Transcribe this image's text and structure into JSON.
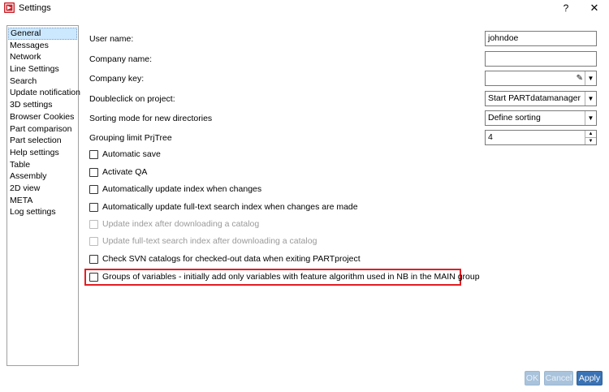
{
  "window": {
    "title": "Settings",
    "help": "?",
    "close": "✕",
    "app_icon": "app-logo-icon"
  },
  "sidebar": {
    "items": [
      {
        "label": "General",
        "selected": true
      },
      {
        "label": "Messages"
      },
      {
        "label": "Network"
      },
      {
        "label": "Line Settings"
      },
      {
        "label": "Search"
      },
      {
        "label": "Update notification"
      },
      {
        "label": "3D settings"
      },
      {
        "label": "Browser Cookies"
      },
      {
        "label": "Part comparison"
      },
      {
        "label": "Part selection"
      },
      {
        "label": "Help settings"
      },
      {
        "label": "Table"
      },
      {
        "label": "Assembly"
      },
      {
        "label": "2D view"
      },
      {
        "label": "META"
      },
      {
        "label": "Log settings"
      }
    ]
  },
  "form": {
    "user_name": {
      "label": "User name:",
      "value": "johndoe"
    },
    "company_name": {
      "label": "Company name:",
      "value": ""
    },
    "company_key": {
      "label": "Company key:",
      "value": ""
    },
    "doubleclick": {
      "label": "Doubleclick on project:",
      "value": "Start PARTdatamanager"
    },
    "sorting": {
      "label": "Sorting mode for new directories",
      "value": "Define sorting"
    },
    "grouping": {
      "label": "Grouping limit PrjTree",
      "value": "4"
    }
  },
  "checkboxes": [
    {
      "label": "Automatic save",
      "checked": false,
      "enabled": true
    },
    {
      "label": "Activate QA",
      "checked": false,
      "enabled": true
    },
    {
      "label": "Automatically update index when changes",
      "checked": false,
      "enabled": true
    },
    {
      "label": "Automatically update full-text search index when changes are made",
      "checked": false,
      "enabled": true
    },
    {
      "label": "Update index after downloading a catalog",
      "checked": false,
      "enabled": false
    },
    {
      "label": "Update full-text search index after downloading a catalog",
      "checked": false,
      "enabled": false
    },
    {
      "label": "Check SVN catalogs for checked-out data when exiting PARTproject",
      "checked": false,
      "enabled": true
    },
    {
      "label": "Groups of variables - initially add only variables with feature algorithm used in NB in the MAIN group",
      "checked": false,
      "enabled": true,
      "highlighted": true
    }
  ],
  "buttons": {
    "ok": "OK",
    "cancel": "Cancel",
    "apply": "Apply"
  },
  "colors": {
    "highlight": "#e31e24",
    "primary_button": "#3a73b5",
    "selection": "#cce8ff",
    "app_icon": "#c8222a"
  }
}
